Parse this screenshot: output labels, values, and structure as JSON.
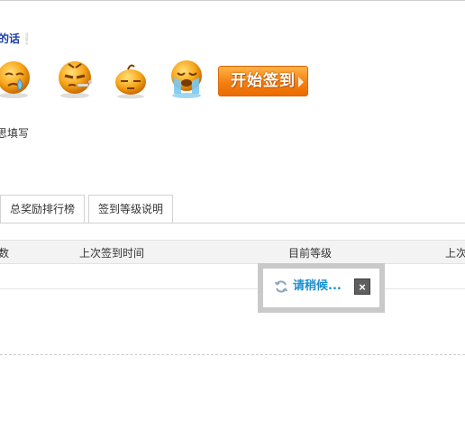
{
  "prompt_text": "的话",
  "moods": [
    {
      "name": "sad-sweat",
      "icon": "sad-sweat-face-icon"
    },
    {
      "name": "sick-smoke",
      "icon": "sick-face-icon"
    },
    {
      "name": "sleepy",
      "icon": "sleepy-face-icon"
    },
    {
      "name": "crying",
      "icon": "crying-face-icon"
    }
  ],
  "signin_button": "开始签到",
  "hint_text": "思填写",
  "tabs": [
    {
      "label": "总奖励排行榜"
    },
    {
      "label": "签到等级说明"
    }
  ],
  "table": {
    "headers": [
      "数",
      "上次签到时间",
      "目前等级",
      "上次"
    ]
  },
  "loading": {
    "text": "请稍候...",
    "close_label": "×"
  },
  "colors": {
    "prompt": "#1c3ea8",
    "button": "#f57f12",
    "loading_text": "#1a8fd0",
    "overlay_frame": "#c9c9c9"
  }
}
